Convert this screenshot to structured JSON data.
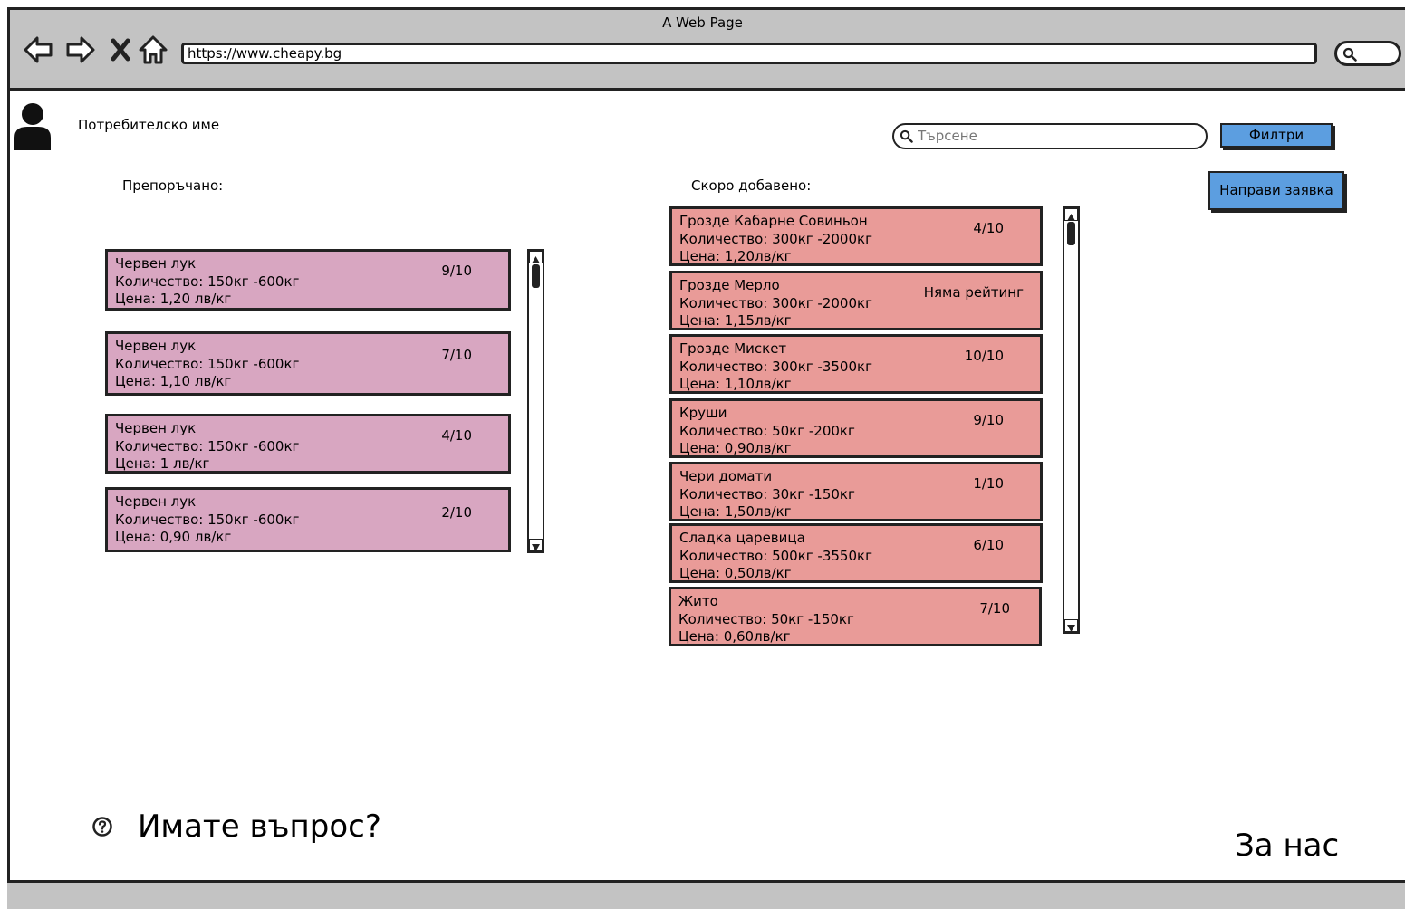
{
  "window": {
    "title": "A Web Page"
  },
  "browser": {
    "url": "https://www.cheapy.bg"
  },
  "header": {
    "username": "Потребителско име",
    "search_placeholder": "Търсене",
    "filter_label": "Филтри",
    "request_label": "Направи заявка"
  },
  "recommended": {
    "label": "Препоръчано:",
    "items": [
      {
        "name": "Червен лук",
        "quantity": "Количество: 150кг -600кг",
        "price": "Цена: 1,20 лв/кг",
        "rating": "9/10"
      },
      {
        "name": "Червен лук",
        "quantity": "Количество: 150кг -600кг",
        "price": "Цена: 1,10 лв/кг",
        "rating": "7/10"
      },
      {
        "name": "Червен лук",
        "quantity": "Количество: 150кг -600кг",
        "price": "Цена: 1 лв/кг",
        "rating": "4/10"
      },
      {
        "name": "Червен лук",
        "quantity": "Количество: 150кг -600кг",
        "price": "Цена: 0,90 лв/кг",
        "rating": "2/10"
      }
    ]
  },
  "recent": {
    "label": "Скоро добавено:",
    "items": [
      {
        "name": "Грозде Кабарне Совиньон",
        "quantity": "Количество: 300кг -2000кг",
        "price": "Цена: 1,20лв/кг",
        "rating": "4/10"
      },
      {
        "name": "Грозде Мерло",
        "quantity": "Количество: 300кг -2000кг",
        "price": "Цена: 1,15лв/кг",
        "rating": "Няма рейтинг"
      },
      {
        "name": "Грозде Мискет",
        "quantity": "Количество: 300кг -3500кг",
        "price": "Цена: 1,10лв/кг",
        "rating": "10/10"
      },
      {
        "name": "Круши",
        "quantity": "Количество: 50кг -200кг",
        "price": "Цена: 0,90лв/кг",
        "rating": "9/10"
      },
      {
        "name": "Чери домати",
        "quantity": "Количество: 30кг -150кг",
        "price": "Цена: 1,50лв/кг",
        "rating": "1/10"
      },
      {
        "name": "Сладка царевица",
        "quantity": "Количество: 500кг -3550кг",
        "price": "Цена: 0,50лв/кг",
        "rating": "6/10"
      },
      {
        "name": "Жито",
        "quantity": "Количество: 50кг -150кг",
        "price": "Цена: 0,60лв/кг",
        "rating": "7/10"
      }
    ]
  },
  "footer": {
    "question": "Имате въпрос?",
    "about": "За нас"
  }
}
